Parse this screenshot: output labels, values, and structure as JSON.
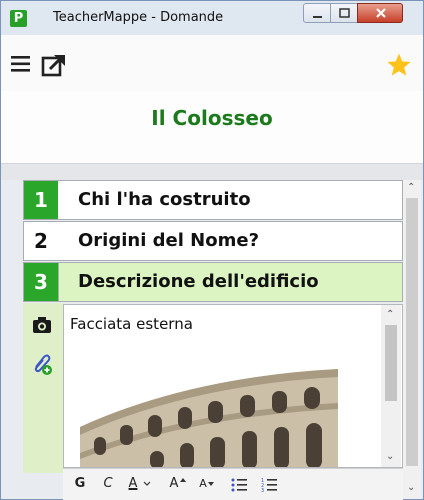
{
  "window": {
    "title": "TeacherMappe - Domande",
    "app_icon_letter": "P",
    "app_icon_color": "#27a027"
  },
  "toolbar": {
    "menu_icon": "hamburger-menu-icon",
    "open_icon": "open-external-icon",
    "star_icon": "star-icon",
    "star_color": "#ffc21a"
  },
  "page": {
    "title": "Il Colosseo",
    "title_color": "#1c7a1c"
  },
  "items": [
    {
      "number": "1",
      "label": "Chi l'ha costruito",
      "highlight_number": true
    },
    {
      "number": "2",
      "label": "Origini del Nome?",
      "highlight_number": false
    },
    {
      "number": "3",
      "label": "Descrizione dell'edificio",
      "highlight_number": true,
      "selected": true
    }
  ],
  "detail": {
    "text": "Facciata esterna",
    "side_icons": [
      "camera-icon",
      "attachment-add-icon"
    ]
  },
  "format_bar": {
    "bold": "G",
    "italic": "C",
    "font_color": "A",
    "grow": "A",
    "shrink": "A"
  },
  "colors": {
    "accent_green": "#2aa62a",
    "selected_row": "#dcf4c2",
    "side_panel": "#dff0c8"
  }
}
